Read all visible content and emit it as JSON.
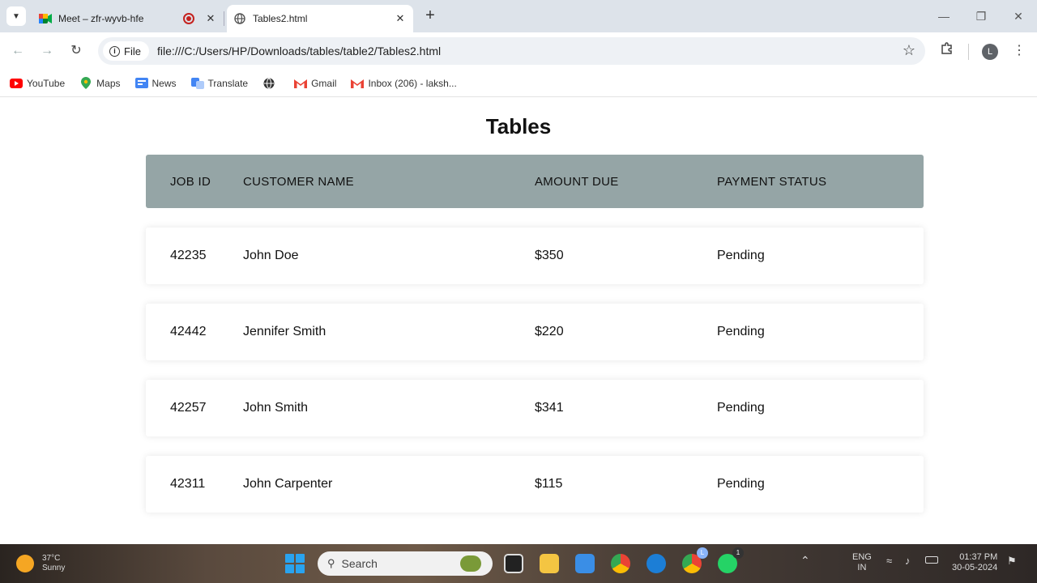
{
  "browser": {
    "tabs": [
      {
        "title": "Meet – zfr-wyvb-hfe",
        "active": false
      },
      {
        "title": "Tables2.html",
        "active": true
      }
    ],
    "address": {
      "scheme_label": "File",
      "url": "file:///C:/Users/HP/Downloads/tables/table2/Tables2.html"
    },
    "profile_initial": "L",
    "bookmarks": [
      {
        "label": "YouTube",
        "icon": "youtube-icon"
      },
      {
        "label": "Maps",
        "icon": "maps-icon"
      },
      {
        "label": "News",
        "icon": "news-icon"
      },
      {
        "label": "Translate",
        "icon": "translate-icon"
      },
      {
        "label": "",
        "icon": "globe-icon"
      },
      {
        "label": "Gmail",
        "icon": "gmail-icon"
      },
      {
        "label": "Inbox (206) - laksh...",
        "icon": "gmail-icon"
      }
    ]
  },
  "page": {
    "title": "Tables",
    "table": {
      "headers": [
        "JOB ID",
        "CUSTOMER NAME",
        "AMOUNT DUE",
        "PAYMENT STATUS"
      ],
      "rows": [
        [
          "42235",
          "John Doe",
          "$350",
          "Pending"
        ],
        [
          "42442",
          "Jennifer Smith",
          "$220",
          "Pending"
        ],
        [
          "42257",
          "John Smith",
          "$341",
          "Pending"
        ],
        [
          "42311",
          "John Carpenter",
          "$115",
          "Pending"
        ]
      ]
    }
  },
  "taskbar": {
    "weather": {
      "temp": "37°C",
      "condition": "Sunny"
    },
    "search_placeholder": "Search",
    "language": {
      "lang": "ENG",
      "region": "IN"
    },
    "clock": {
      "time": "01:37 PM",
      "date": "30-05-2024"
    },
    "badges": {
      "chrome_profile": "L",
      "whatsapp": "1"
    }
  },
  "colors": {
    "header_bg": "#95a5a6",
    "tab_strip": "#dde3ea",
    "omnibox": "#eef1f5"
  }
}
